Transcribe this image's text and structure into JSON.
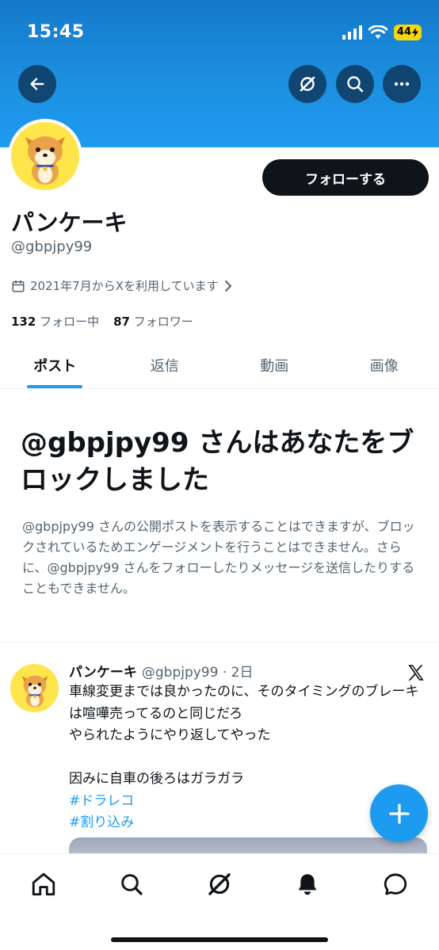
{
  "status_bar": {
    "time": "15:45",
    "battery": "44"
  },
  "profile": {
    "name": "パンケーキ",
    "handle": "@gbpjpy99",
    "follow_label": "フォローする",
    "joined": "2021年7月からXを利用しています",
    "following_count": "132",
    "following_label": "フォロー中",
    "followers_count": "87",
    "followers_label": "フォロワー"
  },
  "tabs": [
    {
      "label": "ポスト",
      "active": true
    },
    {
      "label": "返信",
      "active": false
    },
    {
      "label": "動画",
      "active": false
    },
    {
      "label": "画像",
      "active": false
    }
  ],
  "blocked_notice": {
    "title": "@gbpjpy99 さんはあなたをブロックしました",
    "body": "@gbpjpy99 さんの公開ポストを表示することはできますが、ブロックされているためエンゲージメントを行うことはできません。さらに、@gbpjpy99 さんをフォローしたりメッセージを送信したりすることもできません。"
  },
  "tweet": {
    "name": "パンケーキ",
    "meta": "@gbpjpy99 · 2日",
    "line1": "車線変更までは良かったのに、そのタイミングのブレーキは喧嘩売ってるのと同じだろ",
    "line2": "やられたようにやり返してやった",
    "line3": "因みに自車の後ろはガラガラ",
    "hashtag1": "#ドラレコ",
    "hashtag2": "#割り込み"
  },
  "colors": {
    "accent": "#1d9bf0",
    "banner": "#1d8fe0",
    "text": "#0f1419",
    "muted": "#536471",
    "avatar_bg": "#ffe54c"
  },
  "icons": {
    "back": "back-arrow-icon",
    "grok": "grok-icon",
    "search": "search-icon",
    "more": "more-icon",
    "calendar": "calendar-icon",
    "chevron": "chevron-right-icon",
    "x_logo": "x-logo-icon",
    "compose": "plus-icon",
    "nav_home": "home-icon",
    "nav_search": "search-icon",
    "nav_grok": "grok-icon",
    "nav_notifications": "bell-icon",
    "nav_messages": "message-icon"
  }
}
